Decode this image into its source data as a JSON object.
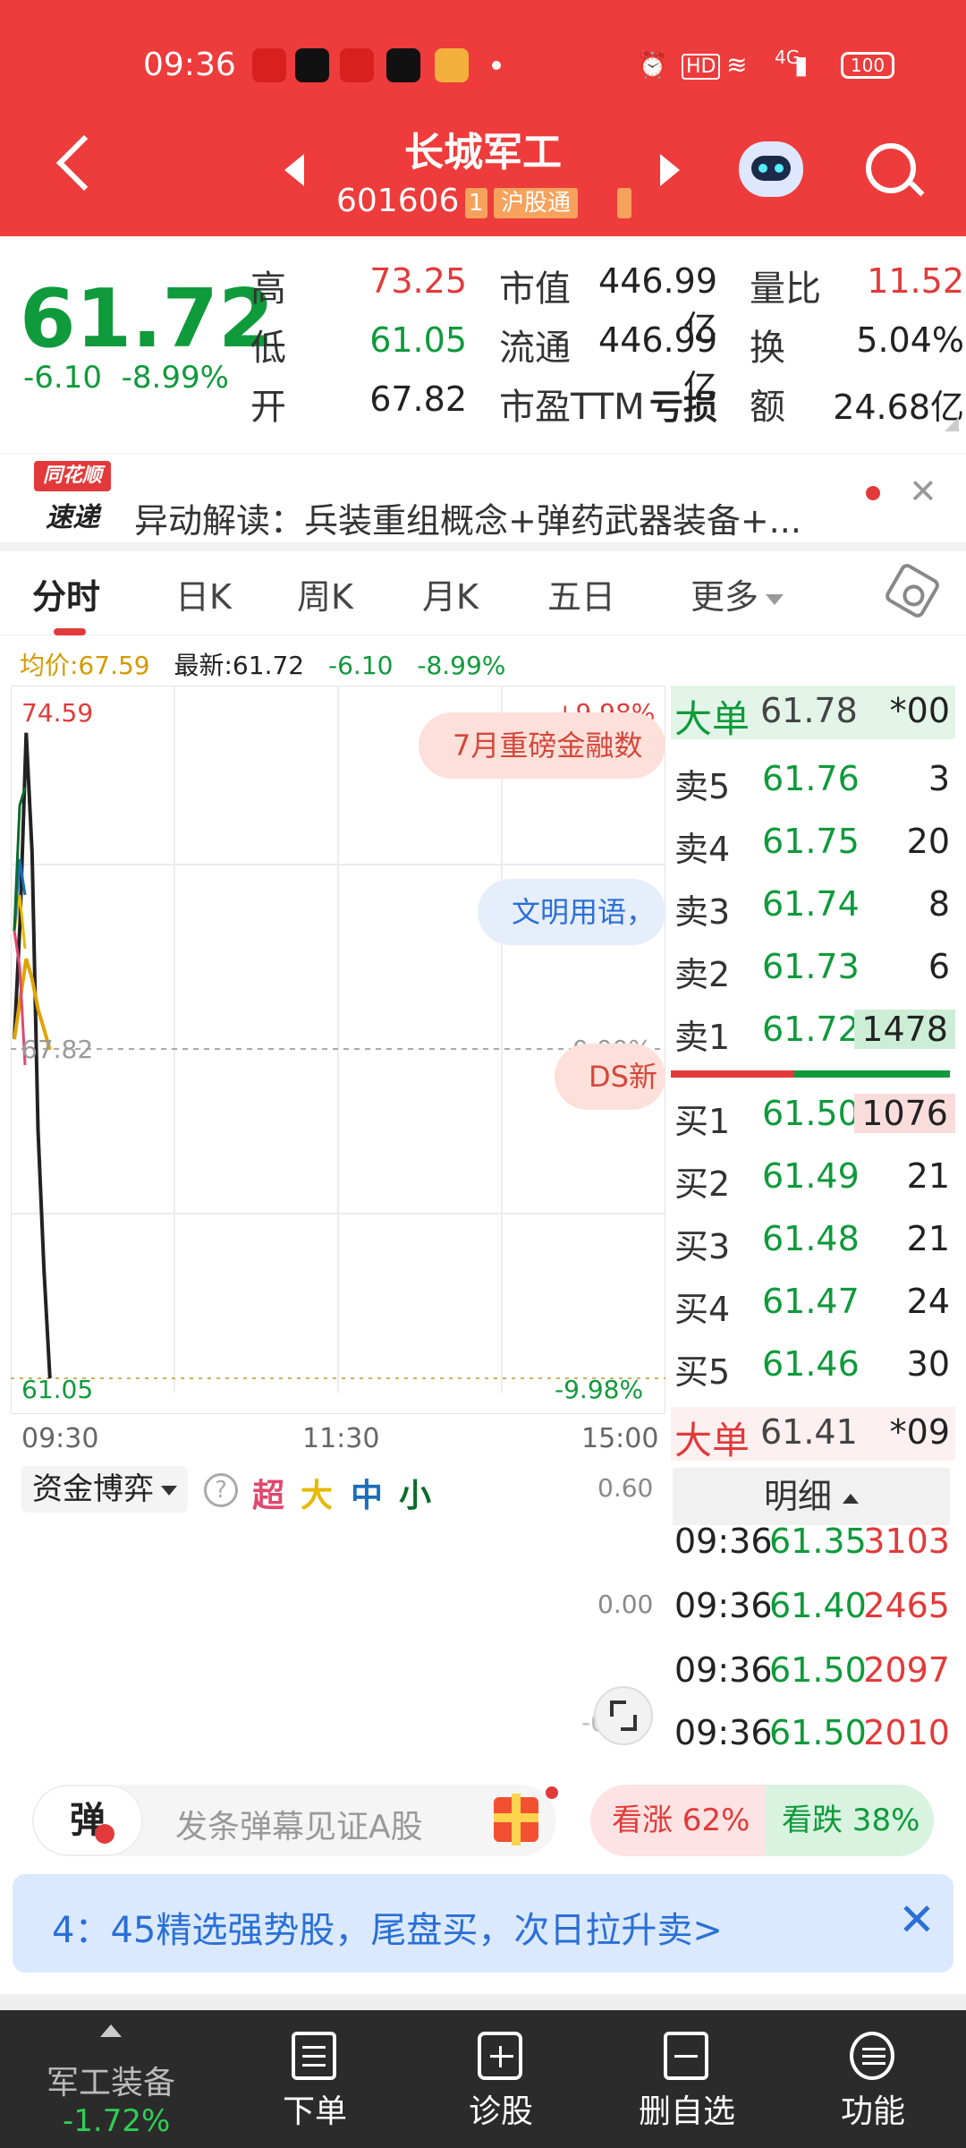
{
  "status_bar": {
    "time": "09:36",
    "network": "4G",
    "battery": "100"
  },
  "header": {
    "title": "长城军工",
    "code": "601606",
    "tag_num": "1",
    "tag_market": "沪股通"
  },
  "quote": {
    "price": "61.72",
    "change": "-6.10",
    "change_pct": "-8.99%",
    "high_label": "高",
    "high": "73.25",
    "low_label": "低",
    "low": "61.05",
    "open_label": "开",
    "open": "67.82",
    "mcap_label": "市值",
    "mcap": "446.99亿",
    "float_label": "流通",
    "float": "446.99亿",
    "pe_label": "市盈TTM",
    "pe": "亏损",
    "vr_label": "量比",
    "vr": "11.52",
    "turnover_label": "换",
    "turnover": "5.04%",
    "amount_label": "额",
    "amount": "24.68亿"
  },
  "news": {
    "logo_top": "同花顺",
    "logo_bottom": "速递",
    "text": "异动解读：兵装重组概念+弹药武器装备+..."
  },
  "tabs": [
    {
      "label": "分时"
    },
    {
      "label": "日K"
    },
    {
      "label": "周K"
    },
    {
      "label": "月K"
    },
    {
      "label": "五日"
    },
    {
      "label": "更多"
    }
  ],
  "avg_row": {
    "avg": "均价:67.59",
    "latest": "最新:61.72",
    "chg": "-6.10",
    "pct": "-8.99%"
  },
  "chart": {
    "y_top": "74.59",
    "y_mid": "67.82",
    "y_bot": "61.05",
    "pct_top": "+9.98%",
    "pct_mid": "0.00%",
    "pct_bot": "-9.98%",
    "x_start": "09:30",
    "x_mid": "11:30",
    "x_end": "15:00",
    "bubble1": "7月重磅金融数",
    "bubble2": "文明用语，",
    "bubble3": "DS新"
  },
  "chart_data": {
    "type": "line",
    "ylim": [
      61.05,
      74.59
    ],
    "x": [
      "09:30",
      "09:31",
      "09:32",
      "09:33",
      "09:34",
      "09:35",
      "09:36"
    ],
    "series": [
      {
        "values": [
          67.8,
          70.2,
          73.9,
          71.5,
          66.0,
          63.2,
          61.05
        ],
        "color": "#222222"
      },
      {
        "values": [
          67.8,
          68.6,
          69.4,
          69.0,
          68.4,
          68.0,
          67.59
        ],
        "color": "#e0a300"
      }
    ],
    "grid": true
  },
  "orderbook": {
    "big_top": {
      "label": "大单",
      "price": "61.78",
      "vol": "*00"
    },
    "asks": [
      {
        "label": "卖5",
        "price": "61.76",
        "vol": "3"
      },
      {
        "label": "卖4",
        "price": "61.75",
        "vol": "20"
      },
      {
        "label": "卖3",
        "price": "61.74",
        "vol": "8"
      },
      {
        "label": "卖2",
        "price": "61.73",
        "vol": "6"
      },
      {
        "label": "卖1",
        "price": "61.72",
        "vol": "1478"
      }
    ],
    "bids": [
      {
        "label": "买1",
        "price": "61.50",
        "vol": "1076"
      },
      {
        "label": "买2",
        "price": "61.49",
        "vol": "21"
      },
      {
        "label": "买3",
        "price": "61.48",
        "vol": "21"
      },
      {
        "label": "买4",
        "price": "61.47",
        "vol": "24"
      },
      {
        "label": "买5",
        "price": "61.46",
        "vol": "30"
      }
    ],
    "big_bottom": {
      "label": "大单",
      "price": "61.41",
      "vol": "*09"
    },
    "detail_label": "明细",
    "ticks": [
      {
        "time": "09:36",
        "price": "61.35",
        "vol": "3103"
      },
      {
        "time": "09:36",
        "price": "61.40",
        "vol": "2465"
      },
      {
        "time": "09:36",
        "price": "61.50",
        "vol": "2097"
      },
      {
        "time": "09:36",
        "price": "61.50",
        "vol": "2010"
      }
    ]
  },
  "flow": {
    "label": "资金博弈",
    "help": "?",
    "legend": [
      "超",
      "大",
      "中",
      "小"
    ],
    "y_top": "0.60",
    "y_mid": "0.00",
    "y_bot": "-0.60"
  },
  "danmaku": {
    "icon_label": "弹",
    "placeholder": "发条弹幕见证A股",
    "up": "看涨 62%",
    "down": "看跌 38%"
  },
  "promo": {
    "text": "4：45精选强势股，尾盘买，次日拉升卖>"
  },
  "bottom_nav": {
    "sector_name": "军工装备",
    "sector_chg": "-1.72%",
    "items": [
      {
        "label": "下单"
      },
      {
        "label": "诊股"
      },
      {
        "label": "删自选"
      },
      {
        "label": "功能"
      }
    ]
  }
}
